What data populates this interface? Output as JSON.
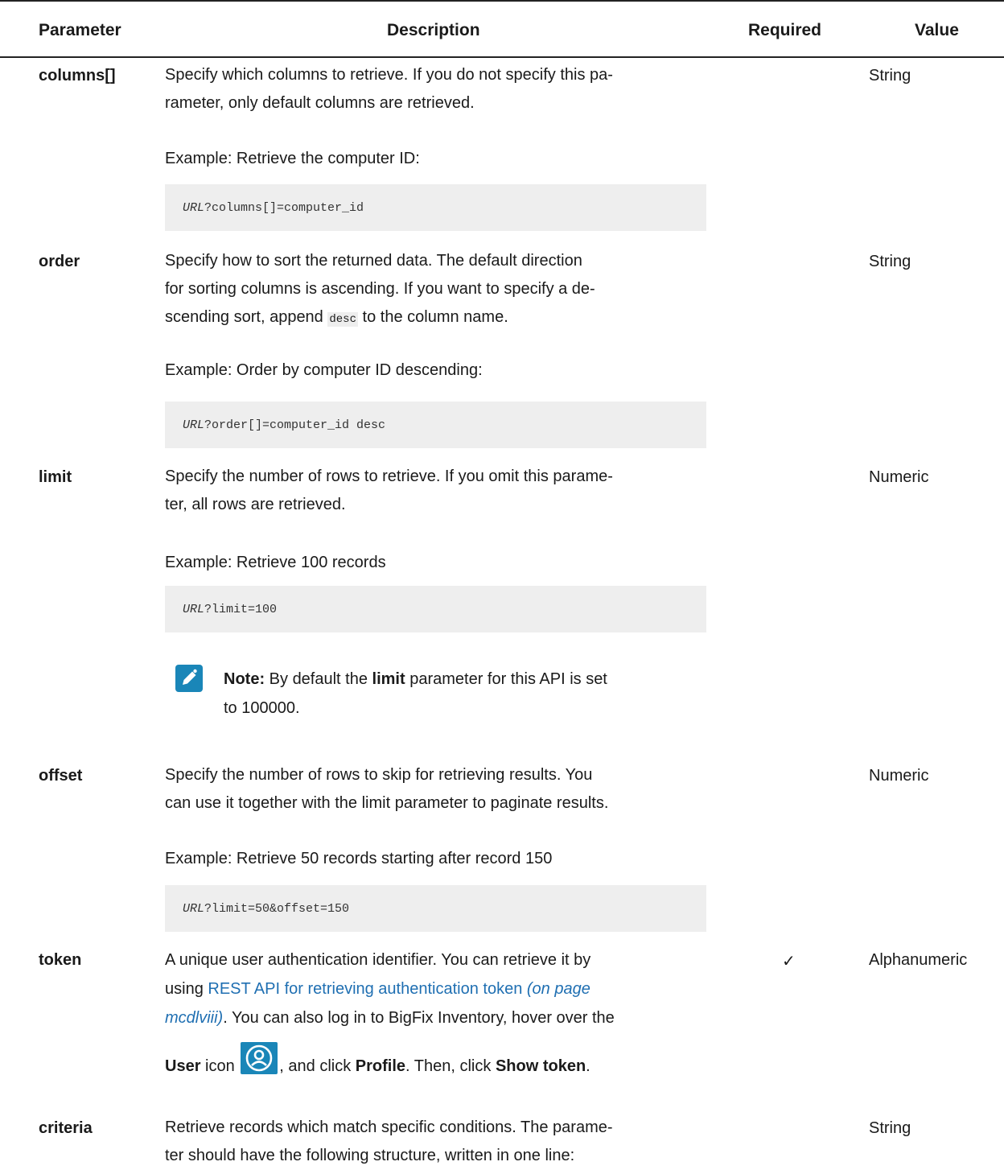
{
  "table": {
    "columns": [
      "Parameter",
      "Description",
      "Required",
      "Value"
    ],
    "rows": [
      {
        "name": "columns[]",
        "desc": [
          "Specify which columns to retrieve. If you do not specify this pa-",
          "rameter, only default columns are retrieved."
        ],
        "example": "Example: Retrieve the computer ID:",
        "code_prefix": "URL",
        "code_rest": "?columns[]=computer_id",
        "required": "",
        "value": "String"
      },
      {
        "name": "order",
        "desc": [
          "Specify how to sort the returned data. The default direction",
          "for sorting columns is ascending. If you want to specify a de-"
        ],
        "desc_line3_a": "scending sort, append ",
        "desc_line3_code": "desc",
        "desc_line3_b": " to the column name.",
        "example": "Example: Order by computer ID descending:",
        "code_prefix": "URL",
        "code_rest": "?order[]=computer_id desc",
        "required": "",
        "value": "String"
      },
      {
        "name": "limit",
        "desc": [
          "Specify the number of rows to retrieve. If you omit this parame-",
          "ter, all rows are retrieved."
        ],
        "example": "Example: Retrieve 100 records",
        "code_prefix": "URL",
        "code_rest": "?limit=100",
        "note_label": "Note:",
        "note_a": " By default the ",
        "note_bold": "limit",
        "note_b": " parameter for this API is set",
        "note_line2": "to 100000.",
        "required": "",
        "value": "Numeric"
      },
      {
        "name": "offset",
        "desc": [
          "Specify the number of rows to skip for retrieving results. You",
          "can use it together with the limit parameter to paginate results."
        ],
        "example": "Example: Retrieve 50 records starting after record 150",
        "code_prefix": "URL",
        "code_rest": "?limit=50&offset=150",
        "required": "",
        "value": "Numeric"
      },
      {
        "name": "token",
        "desc_line1": "A unique user authentication identifier. You can retrieve it by",
        "desc_line2_a": "using ",
        "link_text": "REST API for retrieving authentication token",
        "link_page_a": " (on page",
        "link_page_b": "mcdlviii)",
        "desc_line3_b": ". You can also log in to BigFix Inventory, hover over the",
        "user_bold": "User",
        "icon_word": " icon ",
        "after_icon": ", and click ",
        "profile_bold": "Profile",
        "then_click": ". Then, click ",
        "show_token_bold": "Show token",
        "end_period": ".",
        "required": "✓",
        "value": "Alphanumeric"
      },
      {
        "name": "criteria",
        "desc": [
          "Retrieve records which match specific conditions. The parame-",
          "ter should have the following structure, written in one line:"
        ],
        "required": "",
        "value": "String"
      }
    ]
  },
  "icons": {
    "note": "pencil-icon",
    "user": "user-profile-icon",
    "note_color": "#1a86b8",
    "link_color": "#1f6fb2"
  }
}
